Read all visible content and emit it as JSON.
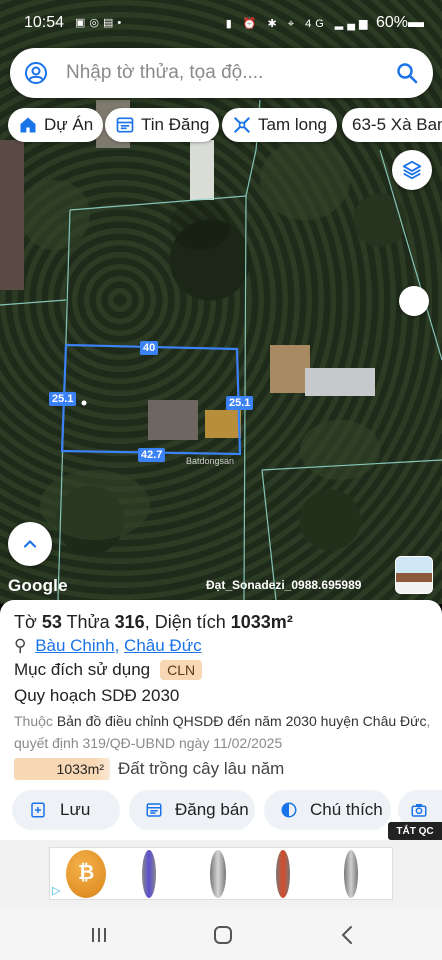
{
  "status_bar": {
    "time": "10:54",
    "left_icons": [
      "zalo-icon",
      "messenger-icon",
      "gallery-icon",
      "dot-icon"
    ],
    "right_icons": [
      "battery-saver-icon",
      "alarm-icon",
      "settings-icon",
      "location-icon",
      "4g-icon",
      "signal-icon"
    ],
    "battery": "60%"
  },
  "search": {
    "placeholder": "Nhập tờ thửa, tọa độ...."
  },
  "chips": [
    {
      "label": "Dự Án",
      "icon": "home-icon"
    },
    {
      "label": "Tin Đăng",
      "icon": "list-icon"
    },
    {
      "label": "Tam long",
      "icon": "pin-tool-icon"
    },
    {
      "label": "63-5 Xà Ban",
      "icon": ""
    }
  ],
  "map": {
    "dimensions": {
      "top": "40",
      "left": "25.1",
      "right": "25.1",
      "bottom": "42.7"
    },
    "watermark": "Batdongsan",
    "google_label": "Google",
    "owner_label": "Đạt_Sonadezi_0988.695989"
  },
  "parcel": {
    "sheet_label": "Tờ",
    "sheet": "53",
    "plot_label": "Thửa",
    "plot": "316",
    "area_label": "Diện tích",
    "area": "1033m²",
    "locations": [
      "Bàu Chinh",
      "Châu Đức"
    ],
    "location_sep": ",",
    "purpose_label": "Mục đích sử dụng",
    "purpose_code": "CLN",
    "plan_title": "Quy hoạch SDĐ 2030",
    "plan_prefix": "Thuộc",
    "plan_source": "Bản đồ điều chỉnh QHSDĐ đến năm 2030 huyện Châu Đức",
    "plan_decision": ", quyết định 319/QĐ-UBND ngày 11/02/2025",
    "land_area": "1033m²",
    "land_type": "Đất trồng cây lâu năm"
  },
  "actions": [
    {
      "label": "Lưu",
      "icon": "save-icon"
    },
    {
      "label": "Đăng bán",
      "icon": "post-icon"
    },
    {
      "label": "Chú thích",
      "icon": "legend-icon"
    },
    {
      "label": "",
      "icon": "camera-icon"
    }
  ],
  "ad": {
    "close_label": "TẮT QC",
    "adchoices": "▷"
  },
  "colors": {
    "accent": "#1a73e8",
    "parcel_line": "#3b82f6",
    "cln_badge": "#f8d8b4"
  }
}
